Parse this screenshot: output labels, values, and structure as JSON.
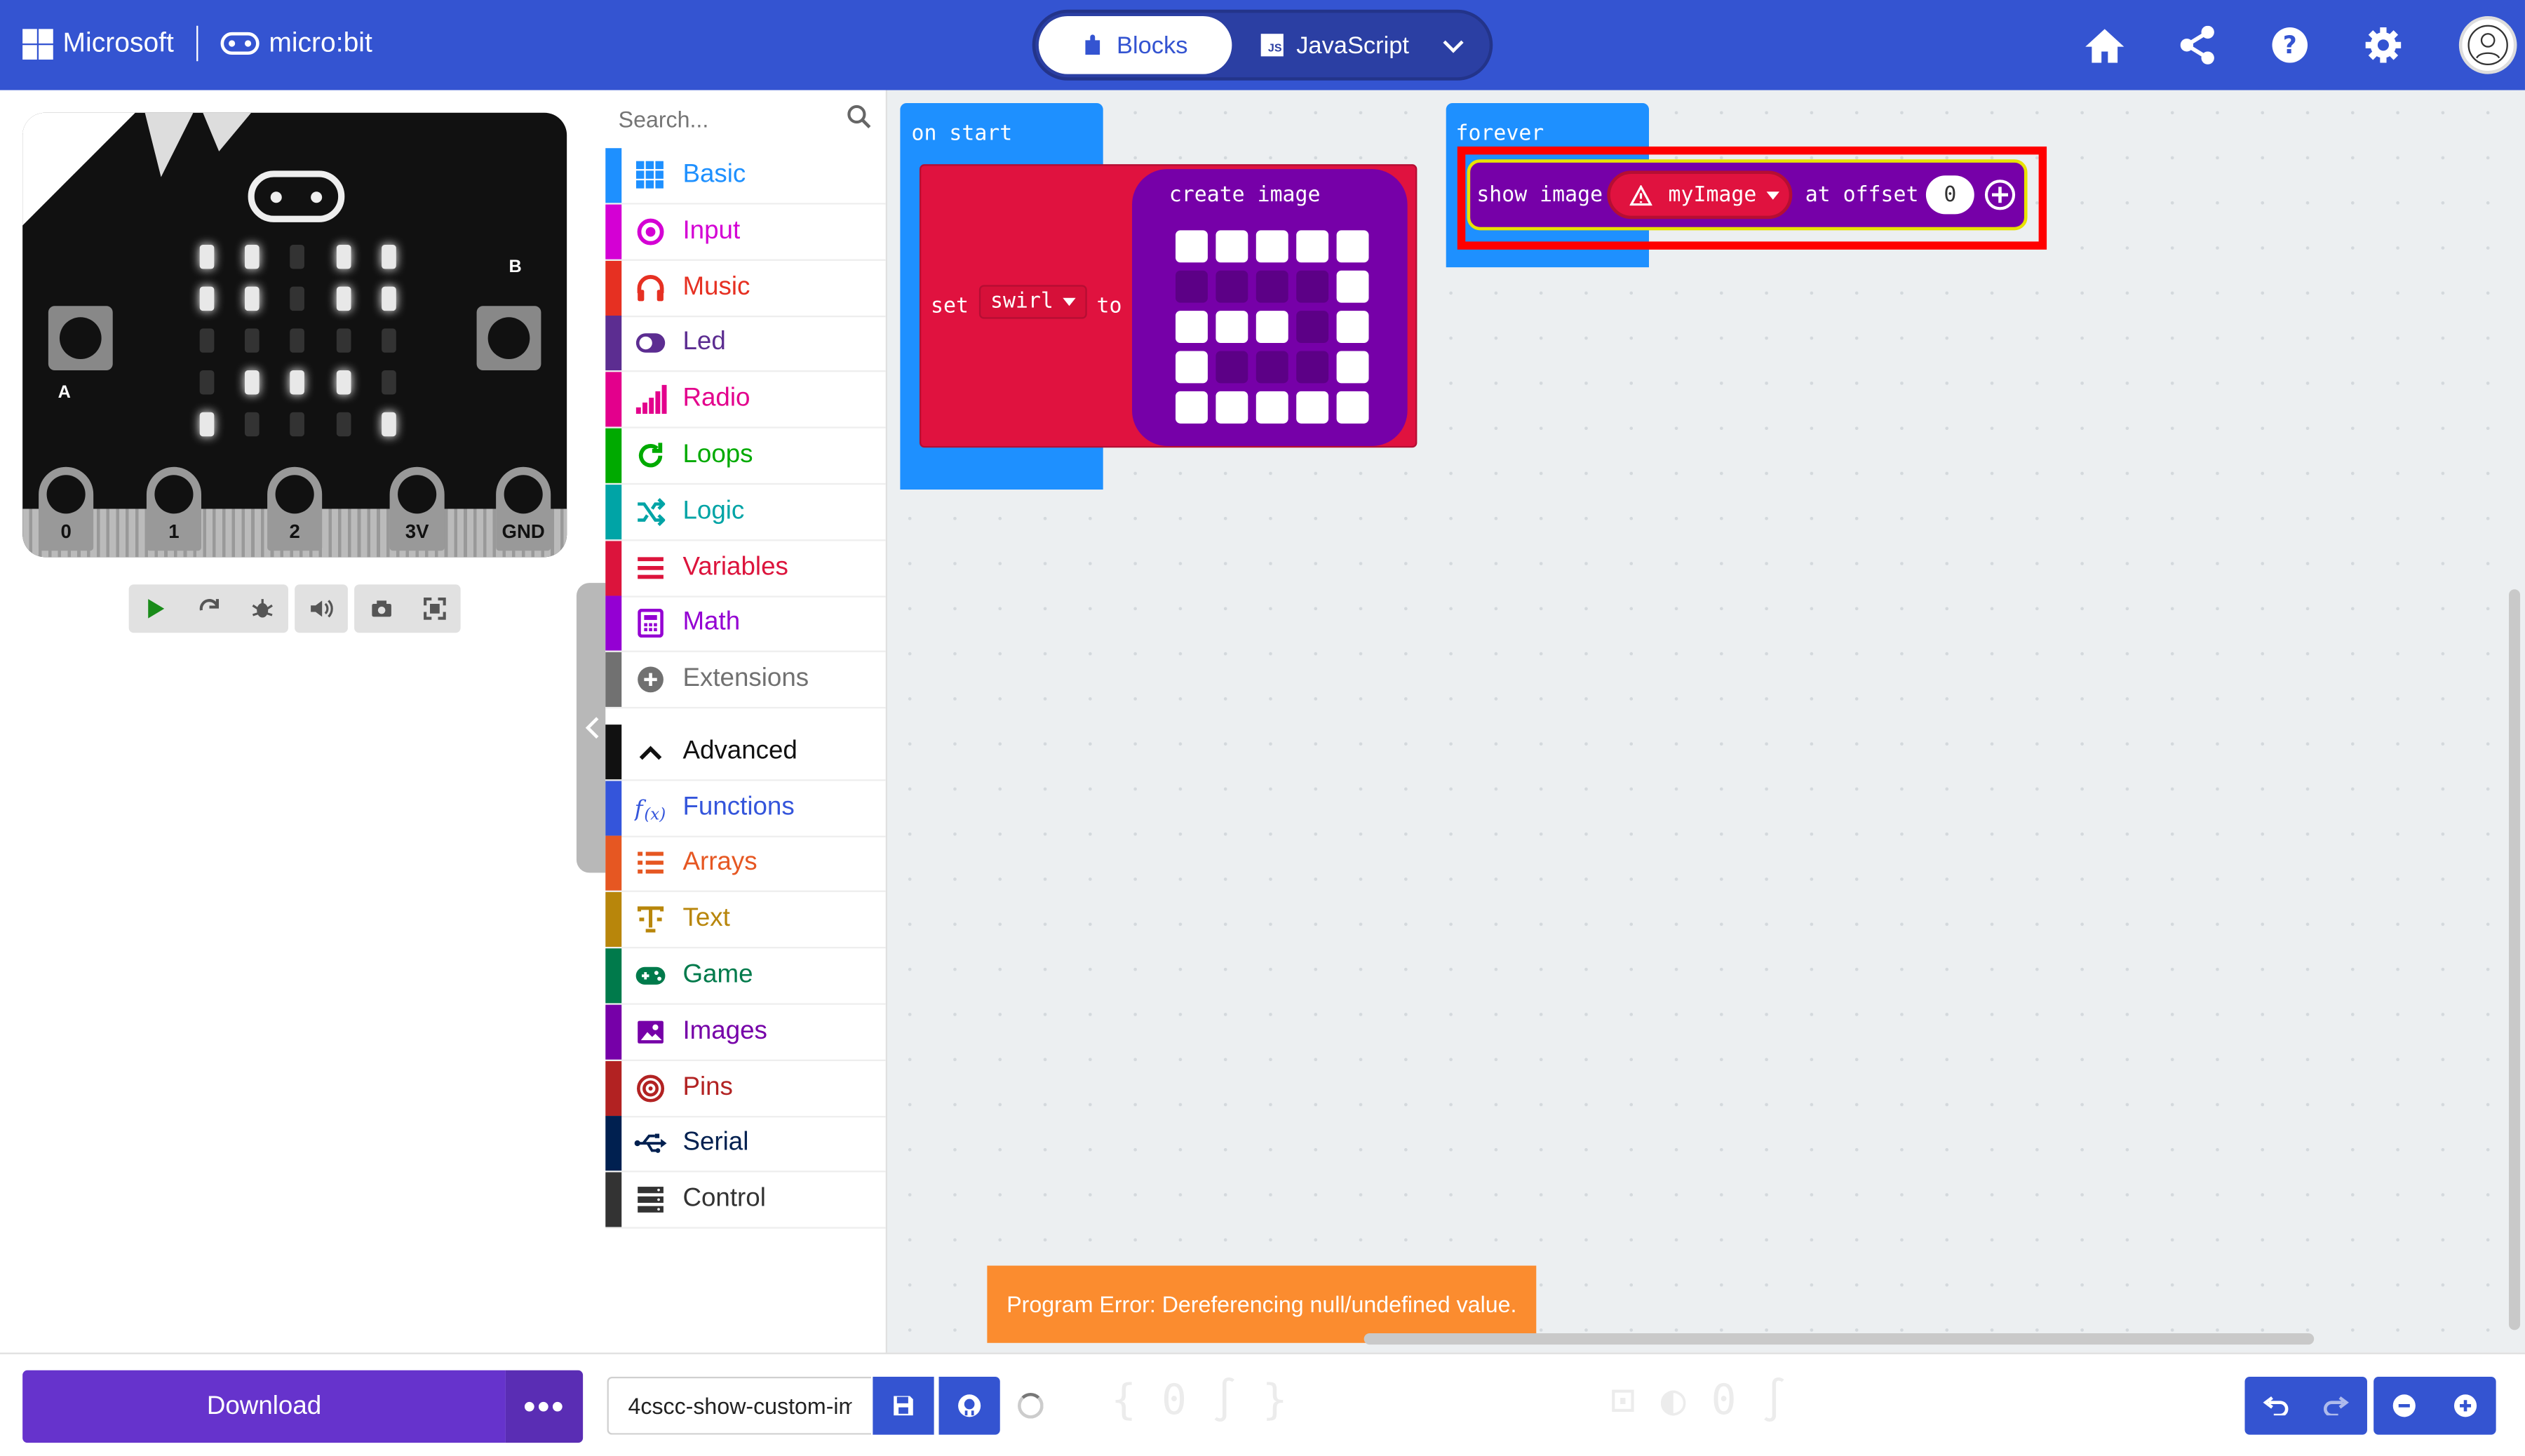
{
  "header": {
    "brand_ms": "Microsoft",
    "brand_mb": "micro:bit",
    "tabs": {
      "blocks": "Blocks",
      "javascript": "JavaScript"
    },
    "js_badge": "JS"
  },
  "simulator": {
    "pins": [
      "0",
      "1",
      "2",
      "3V",
      "GND"
    ],
    "button_a": "A",
    "button_b": "B",
    "led_matrix": [
      [
        1,
        1,
        0,
        1,
        1
      ],
      [
        1,
        1,
        0,
        1,
        1
      ],
      [
        0,
        0,
        0,
        0,
        0
      ],
      [
        0,
        1,
        1,
        1,
        0
      ],
      [
        1,
        0,
        0,
        0,
        1
      ]
    ]
  },
  "toolbox": {
    "search_placeholder": "Search...",
    "categories": [
      {
        "label": "Basic",
        "color": "#1e90ff",
        "icon": "grid-icon"
      },
      {
        "label": "Input",
        "color": "#d400d4",
        "icon": "radio-dot-icon"
      },
      {
        "label": "Music",
        "color": "#e63022",
        "icon": "headphones-icon"
      },
      {
        "label": "Led",
        "color": "#5c2d91",
        "icon": "toggle-icon"
      },
      {
        "label": "Radio",
        "color": "#e3008c",
        "icon": "signal-bars-icon"
      },
      {
        "label": "Loops",
        "color": "#00aa00",
        "icon": "refresh-icon"
      },
      {
        "label": "Logic",
        "color": "#00a4a6",
        "icon": "shuffle-icon"
      },
      {
        "label": "Variables",
        "color": "#dc143c",
        "icon": "lines-icon"
      },
      {
        "label": "Math",
        "color": "#9400d3",
        "icon": "calculator-icon"
      },
      {
        "label": "Extensions",
        "color": "#717171",
        "icon": "plus-circle-icon"
      },
      {
        "label": "Advanced",
        "color": "#111111",
        "icon": "chevron-up-icon"
      },
      {
        "label": "Functions",
        "color": "#3455db",
        "icon": "function-icon"
      },
      {
        "label": "Arrays",
        "color": "#e65722",
        "icon": "list-icon"
      },
      {
        "label": "Text",
        "color": "#b8860b",
        "icon": "text-icon"
      },
      {
        "label": "Game",
        "color": "#007a4b",
        "icon": "gamepad-icon"
      },
      {
        "label": "Images",
        "color": "#7600a8",
        "icon": "image-icon"
      },
      {
        "label": "Pins",
        "color": "#b22222",
        "icon": "target-icon"
      },
      {
        "label": "Serial",
        "color": "#002050",
        "icon": "usb-icon"
      },
      {
        "label": "Control",
        "color": "#333333",
        "icon": "server-icon"
      }
    ]
  },
  "workspace": {
    "on_start": {
      "hat": "on start",
      "set_label": "set",
      "variable": "swirl",
      "to_label": "to",
      "create_image": "create image",
      "image": [
        [
          1,
          1,
          1,
          1,
          1
        ],
        [
          0,
          0,
          0,
          0,
          1
        ],
        [
          1,
          1,
          1,
          0,
          1
        ],
        [
          1,
          0,
          0,
          0,
          1
        ],
        [
          1,
          1,
          1,
          1,
          1
        ]
      ]
    },
    "forever": {
      "hat": "forever",
      "show_image": "show image",
      "var_name": "myImage",
      "at_offset": "at offset",
      "offset_value": "0"
    },
    "error_message": "Program Error: Dereferencing null/undefined value."
  },
  "bottom": {
    "download": "Download",
    "more": "•••",
    "project_name": "4cscc-show-custom-im"
  },
  "colors": {
    "header": "#3454d1",
    "download": "#6633cc",
    "variables_block": "#e0123f",
    "images_block": "#7600a8",
    "event_block": "#1e90ff",
    "error_toast": "#fb8c2f"
  }
}
